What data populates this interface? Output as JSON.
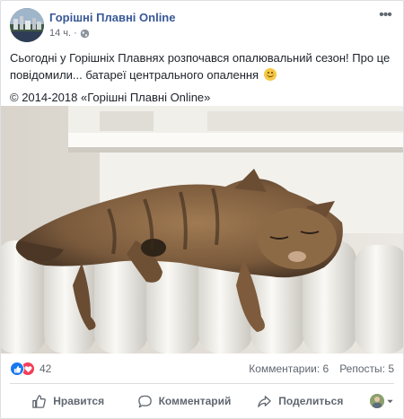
{
  "post": {
    "page_name": "Горішні Плавні Online",
    "time": "14 ч.",
    "text_main": "Сьогодні у Горішніх Плавнях розпочався опалювальний сезон! Про це повідомили... батареї центрального опалення",
    "text_copyright": "© 2014-2018 «Горішні Плавні Online»"
  },
  "stats": {
    "reaction_count": "42",
    "comments": "Комментарии: 6",
    "shares": "Репосты: 5"
  },
  "actions": {
    "like": "Нравится",
    "comment": "Комментарий",
    "share": "Поделиться"
  },
  "icons": {
    "avatar": "city-avatar-image",
    "globe": "globe-icon",
    "more": "more-icon",
    "like_reaction": "like-reaction-icon",
    "love_reaction": "love-reaction-icon"
  },
  "colors": {
    "link": "#385898",
    "like_blue": "#1877f2",
    "love_red": "#f33e58"
  }
}
